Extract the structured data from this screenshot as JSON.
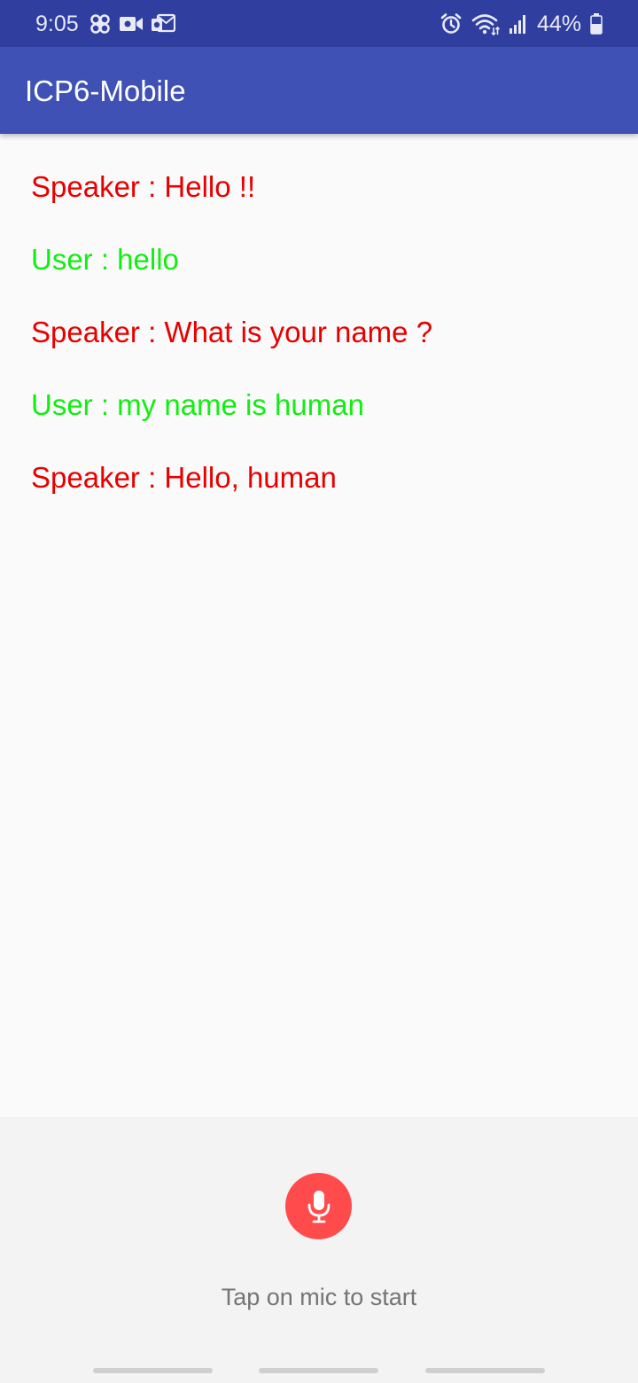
{
  "status_bar": {
    "time": "9:05",
    "battery_percent": "44%",
    "icons": [
      "pinwheel-icon",
      "video-camera-icon",
      "outlook-mail-icon",
      "alarm-icon",
      "wifi-icon",
      "cellular-signal-icon",
      "battery-icon"
    ],
    "background_color": "#303f9f"
  },
  "app_bar": {
    "title": "ICP6-Mobile",
    "background_color": "#3f51b5"
  },
  "messages": [
    {
      "role": "speaker",
      "text": "Speaker : Hello !!",
      "color": "#e60000"
    },
    {
      "role": "user",
      "text": "User : hello",
      "color": "#11ee11"
    },
    {
      "role": "speaker",
      "text": "Speaker : What is your name ?",
      "color": "#e60000"
    },
    {
      "role": "user",
      "text": "User : my name is human",
      "color": "#11ee11"
    },
    {
      "role": "speaker",
      "text": "Speaker : Hello, human",
      "color": "#e60000"
    }
  ],
  "bottom": {
    "mic_icon": "microphone-icon",
    "mic_color": "#ff4b4b",
    "hint": "Tap on mic to start"
  }
}
